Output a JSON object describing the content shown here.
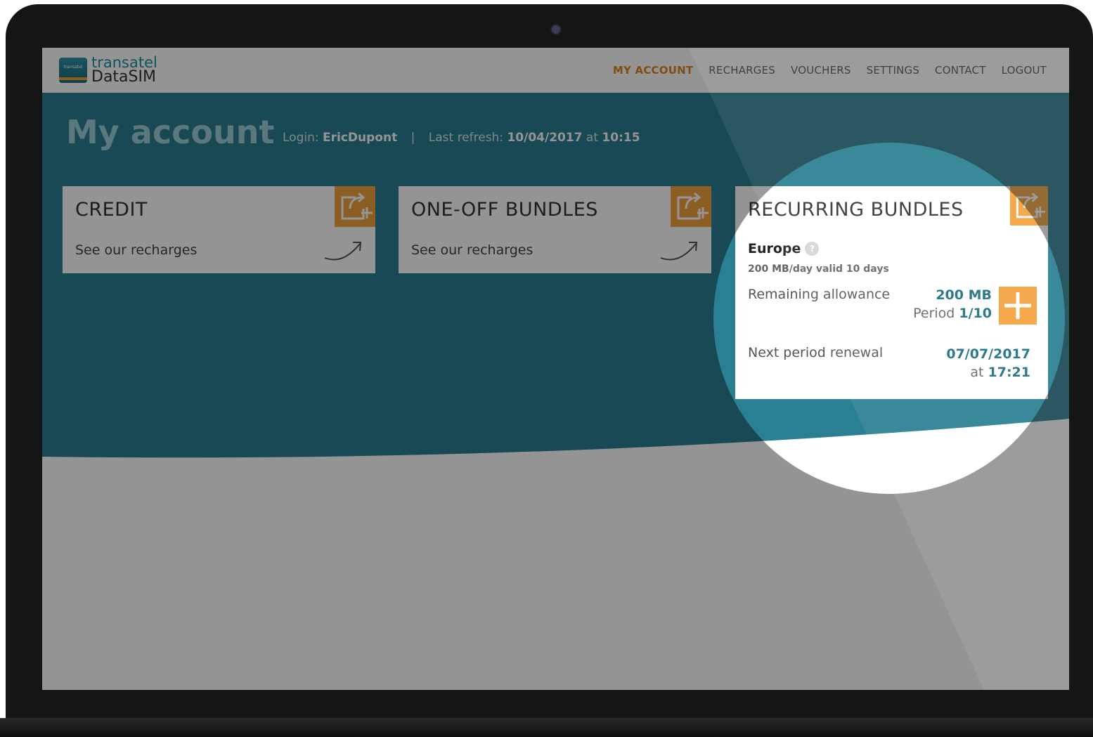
{
  "header": {
    "logo": {
      "line1": "transatel",
      "line2": "DataSIM",
      "mark_text": "transatel"
    },
    "nav": [
      {
        "label": "MY ACCOUNT",
        "active": true
      },
      {
        "label": "RECHARGES",
        "active": false
      },
      {
        "label": "VOUCHERS",
        "active": false
      },
      {
        "label": "SETTINGS",
        "active": false
      },
      {
        "label": "CONTACT",
        "active": false
      },
      {
        "label": "LOGOUT",
        "active": false
      }
    ]
  },
  "page": {
    "title": "My account",
    "login_label": "Login:",
    "login_value": "EricDupont",
    "separator": "|",
    "refresh_label": "Last refresh:",
    "refresh_date": "10/04/2017",
    "refresh_at": "at",
    "refresh_time": "10:15"
  },
  "cards": {
    "credit": {
      "title": "CREDIT",
      "link": "See our recharges"
    },
    "oneoff": {
      "title": "ONE-OFF BUNDLES",
      "link": "See our recharges"
    },
    "recurring": {
      "title": "RECURRING BUNDLES",
      "region": "Europe",
      "help": "?",
      "description": "200 MB/day valid 10 days",
      "remaining_label": "Remaining allowance",
      "remaining_value": "200 MB",
      "period_label": "Period",
      "period_value": "1/10",
      "renewal_label": "Next period renewal",
      "renewal_date": "07/07/2017",
      "renewal_at": "at",
      "renewal_time": "17:21"
    }
  },
  "colors": {
    "teal": "#2a7f92",
    "orange": "#f2a23d",
    "nav_active": "#e0861a",
    "accent_text": "#1e6f82"
  },
  "icons": {
    "card_corner": "export-plus-icon",
    "card_arrow": "curved-arrow-icon",
    "add_button": "plus-icon",
    "help": "help-icon"
  }
}
